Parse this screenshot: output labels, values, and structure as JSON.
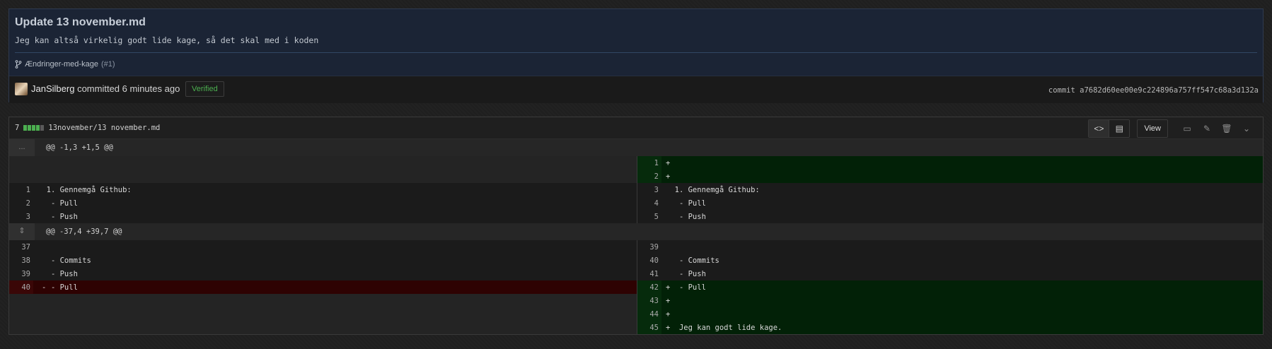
{
  "commit": {
    "title": "Update 13 november.md",
    "description": "Jeg kan altså virkelig godt lide kage, så det skal med i koden",
    "branch": "Ændringer-med-kage",
    "pr": "(#1)",
    "author": "JanSilberg",
    "action": "committed 6 minutes ago",
    "verified": "Verified",
    "sha_label": "commit a7682d60ee00e9c224896a757ff547c68a3d132a"
  },
  "file": {
    "changes": "7",
    "path": "13november/13 november.md",
    "view_label": "View",
    "icons": [
      "code-icon",
      "file-icon",
      "desktop-icon",
      "pencil-icon",
      "trash-icon",
      "chevron-down-icon"
    ]
  },
  "hunks": [
    {
      "header": "@@ -1,3 +1,5 @@",
      "gutter": "..."
    },
    {
      "header": "@@ -37,4 +39,7 @@",
      "gutter": "expand-icon"
    }
  ],
  "rows": {
    "r1": {
      "rn": "1",
      "rs": "+",
      "rc": ""
    },
    "r2": {
      "rn": "2",
      "rs": "+",
      "rc": ""
    },
    "r3": {
      "ln": "1",
      "lc": "  1. Gennemgå Github:",
      "rn": "3",
      "rc": "  1. Gennemgå Github:"
    },
    "r4": {
      "ln": "2",
      "lc": "   - Pull",
      "rn": "4",
      "rc": "   - Pull"
    },
    "r5": {
      "ln": "3",
      "lc": "   - Push",
      "rn": "5",
      "rc": "   - Push"
    },
    "r6": {
      "ln": "37",
      "lc": "",
      "rn": "39",
      "rc": ""
    },
    "r7": {
      "ln": "38",
      "lc": "   - Commits",
      "rn": "40",
      "rc": "   - Commits"
    },
    "r8": {
      "ln": "39",
      "lc": "   - Push",
      "rn": "41",
      "rc": "   - Push"
    },
    "r9": {
      "ln": "40",
      "ls": "-",
      "lc": "   - Pull",
      "rn": "42",
      "rs": "+",
      "rc": "   - Pull"
    },
    "r10": {
      "rn": "43",
      "rs": "+",
      "rc": ""
    },
    "r11": {
      "rn": "44",
      "rs": "+",
      "rc": ""
    },
    "r12": {
      "rn": "45",
      "rs": "+",
      "rc": "   Jeg kan godt lide kage."
    }
  }
}
